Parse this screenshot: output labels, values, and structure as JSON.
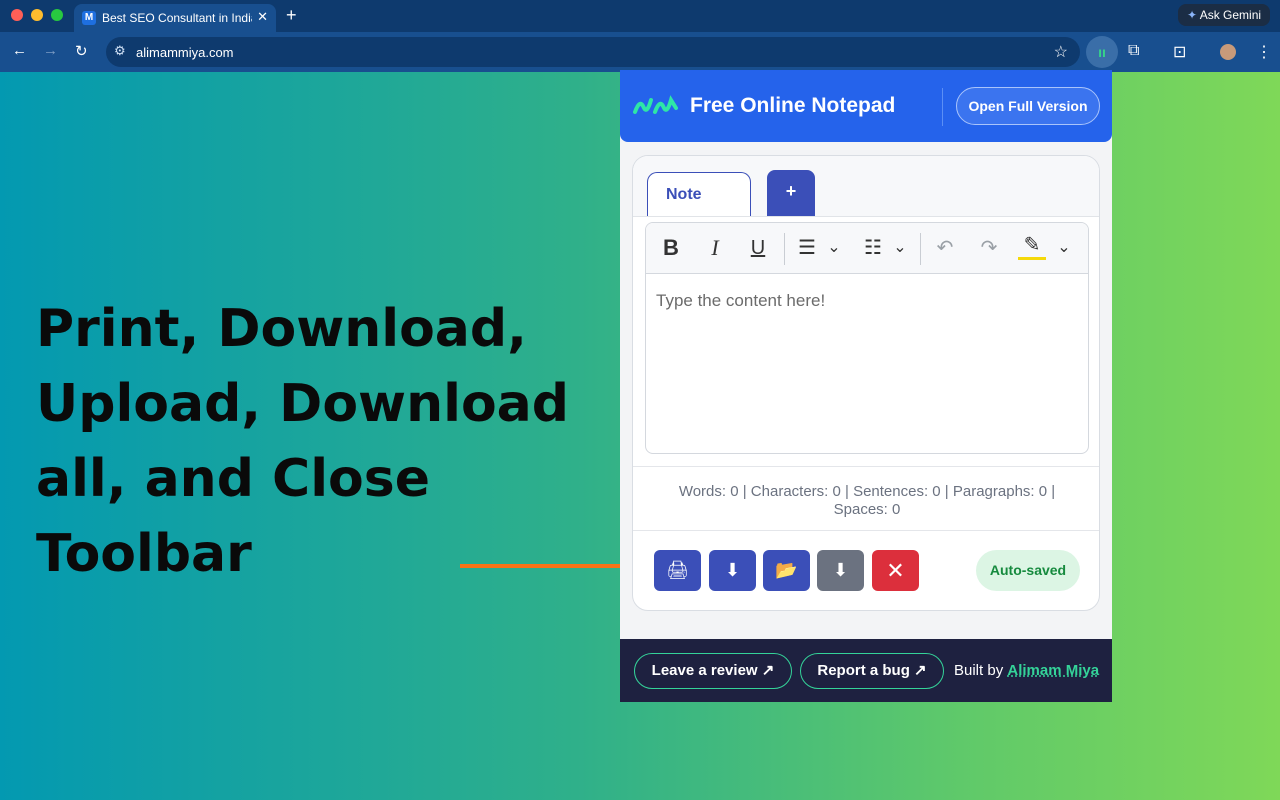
{
  "browser": {
    "tab_title": "Best SEO Consultant in India",
    "tab_favicon": "M",
    "tab_close": "✕",
    "new_tab": "+",
    "gemini_label": "Ask Gemini",
    "url": "alimammiya.com",
    "nav_back": "←",
    "nav_forward": "→",
    "nav_reload": "↻"
  },
  "caption": {
    "line1": "Print, Download,",
    "line2": "Upload, Download",
    "line3": "all, and Close Toolbar"
  },
  "popup": {
    "title": "Free Online Notepad",
    "open_full": "Open Full Version",
    "tabs": {
      "active": "Note",
      "add": "+"
    },
    "toolbar": {
      "bold": "B",
      "italic": "I",
      "underline": "U",
      "bullet": "☰",
      "numbered": "☷",
      "undo": "↶",
      "redo": "↷",
      "highlight": "✎",
      "caret": "⌄"
    },
    "content_placeholder": "Type the content here!",
    "stats": "Words: 0 | Characters: 0 | Sentences: 0 | Paragraphs: 0 | Spaces: 0",
    "actions": {
      "print": "🖨",
      "download": "⬇",
      "upload": "📂",
      "download_all": "⬇",
      "close": "✕",
      "status": "Auto-saved"
    },
    "footer": {
      "review": "Leave a review ↗",
      "bug": "Report a bug ↗",
      "built_by": "Built by ",
      "author": "Alimam Miya"
    }
  },
  "colors": {
    "header_blue": "#2563eb",
    "tab_indigo": "#3b4fb8",
    "close_red": "#dc2f3c",
    "grey_button": "#6b7280",
    "accent_green": "#34d399",
    "arrow_orange": "#f97316"
  }
}
